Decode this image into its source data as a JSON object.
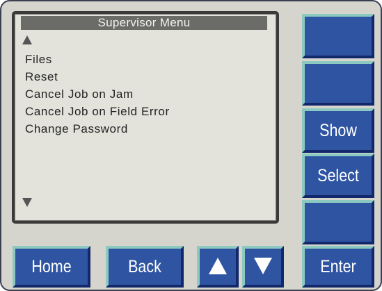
{
  "screen": {
    "title": "Supervisor Menu",
    "scroll_up_icon": "triangle-up",
    "scroll_down_icon": "triangle-down",
    "items": [
      "Files",
      "Reset",
      "Cancel Job on Jam",
      "Cancel Job on Field Error",
      "Change Password"
    ]
  },
  "side_buttons": {
    "soft1": "",
    "soft2": "",
    "show": "Show",
    "select": "Select",
    "soft5": "",
    "enter": "Enter"
  },
  "bottom_buttons": {
    "home": "Home",
    "back": "Back",
    "up_icon": "triangle-up",
    "down_icon": "triangle-down"
  },
  "colors": {
    "button_face": "#2f55a2",
    "button_highlight": "#8cc9c0",
    "panel": "#d6d5cd",
    "lcd": "#e3e3dc",
    "title_bar": "#6b6b68"
  }
}
